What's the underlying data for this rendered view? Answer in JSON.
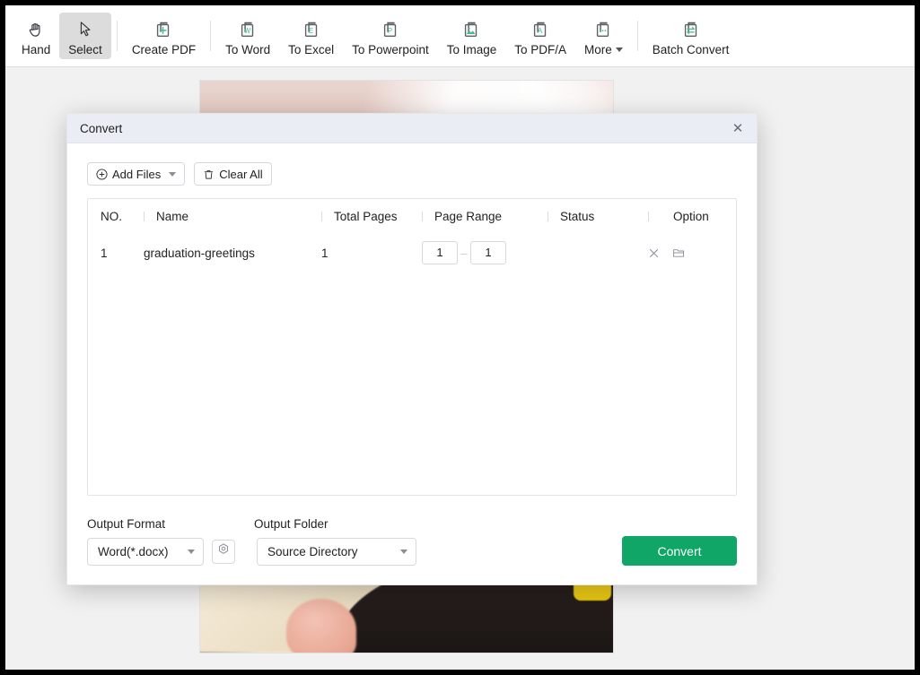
{
  "toolbar": {
    "items": [
      {
        "label": "Hand",
        "icon": "hand-icon",
        "selected": false,
        "caret": false,
        "sep_after": false
      },
      {
        "label": "Select",
        "icon": "cursor-icon",
        "selected": true,
        "caret": false,
        "sep_after": true
      },
      {
        "label": "Create PDF",
        "icon": "create-pdf-icon",
        "selected": false,
        "caret": false,
        "sep_after": true
      },
      {
        "label": "To Word",
        "icon": "to-word-icon",
        "selected": false,
        "caret": false,
        "sep_after": false
      },
      {
        "label": "To Excel",
        "icon": "to-excel-icon",
        "selected": false,
        "caret": false,
        "sep_after": false
      },
      {
        "label": "To Powerpoint",
        "icon": "to-ppt-icon",
        "selected": false,
        "caret": false,
        "sep_after": false
      },
      {
        "label": "To Image",
        "icon": "to-image-icon",
        "selected": false,
        "caret": false,
        "sep_after": false
      },
      {
        "label": "To PDF/A",
        "icon": "to-pdfa-icon",
        "selected": false,
        "caret": false,
        "sep_after": false
      },
      {
        "label": "More",
        "icon": "more-icon",
        "selected": false,
        "caret": true,
        "sep_after": true
      },
      {
        "label": "Batch Convert",
        "icon": "batch-convert-icon",
        "selected": false,
        "caret": false,
        "sep_after": false
      }
    ],
    "accent_color": "#2e8b7a"
  },
  "dialog": {
    "title": "Convert",
    "close_label": "✕",
    "add_files_label": "Add Files",
    "clear_all_label": "Clear All",
    "table": {
      "headers": [
        "NO.",
        "Name",
        "Total Pages",
        "Page Range",
        "Status",
        "Option"
      ],
      "rows": [
        {
          "no": "1",
          "name": "graduation-greetings",
          "total_pages": "1",
          "range_from": "1",
          "range_dash": "–",
          "range_to": "1",
          "status": ""
        }
      ]
    },
    "output_format_label": "Output Format",
    "output_format_value": "Word(*.docx)",
    "output_folder_label": "Output Folder",
    "output_folder_value": "Source Directory",
    "convert_label": "Convert",
    "convert_color": "#0fa667"
  }
}
